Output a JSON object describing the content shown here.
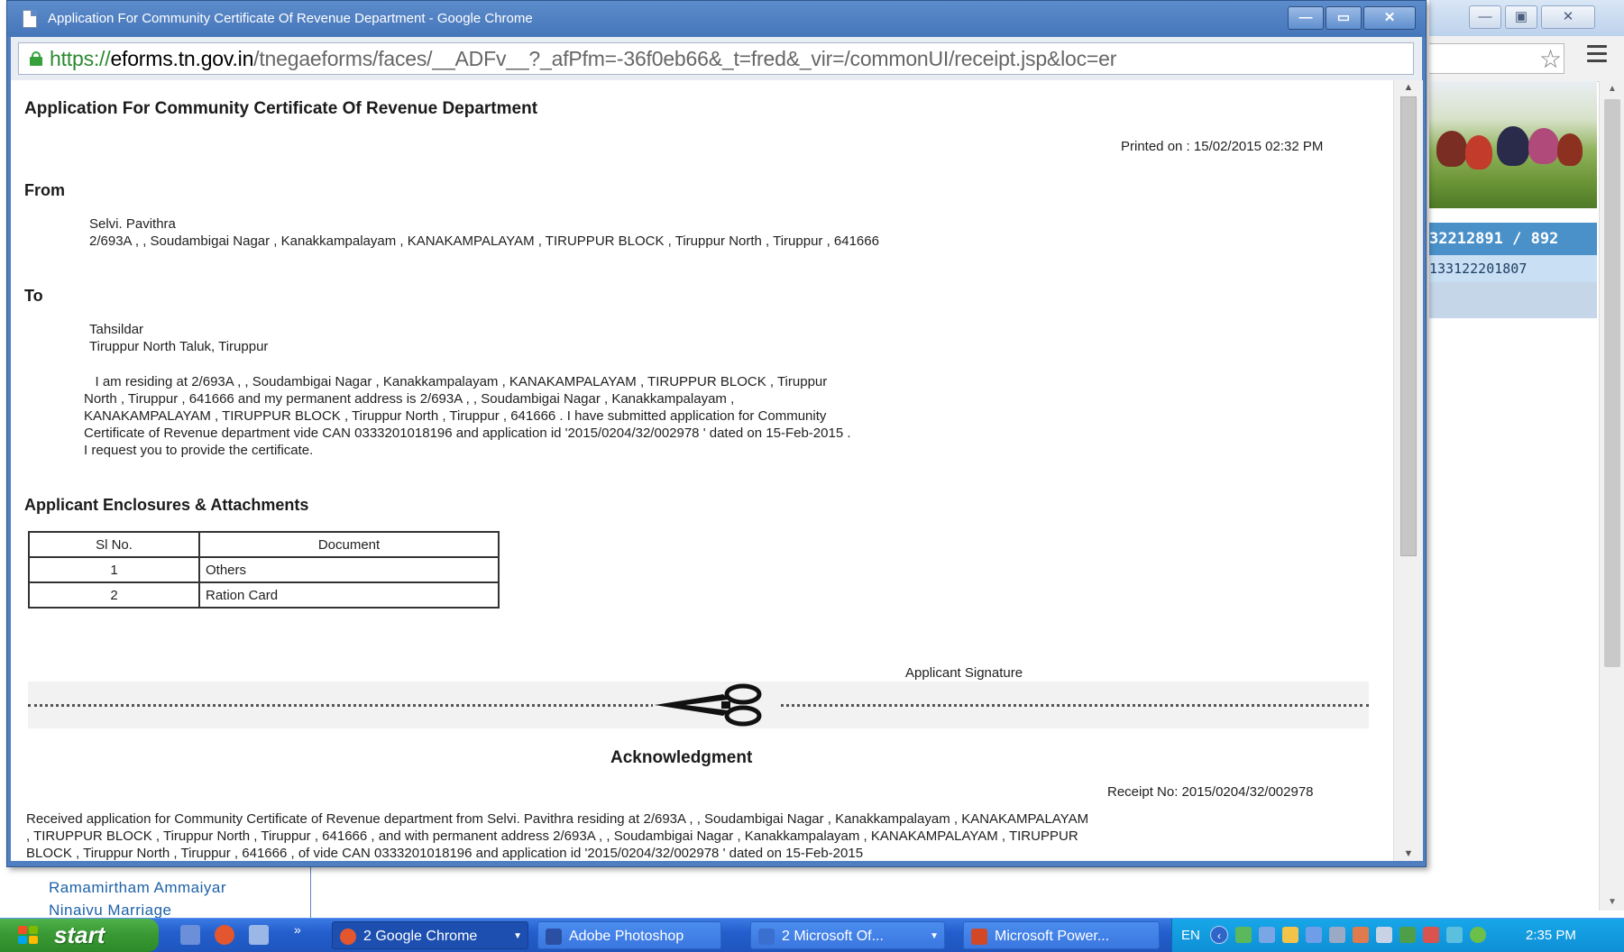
{
  "popup": {
    "title": "Application For Community Certificate Of Revenue Department - Google Chrome",
    "controls": {
      "minimize": "—",
      "maximize": "▭",
      "close": "✕"
    },
    "url_scheme": "https://",
    "url_host": "eforms.tn.gov.in",
    "url_path": "/tnegaeforms/faces/__ADFv__?_afPfm=-36f0eb66&_t=fred&_vir=/commonUI/receipt.jsp&loc=er"
  },
  "document": {
    "heading": "Application For Community Certificate Of Revenue Department",
    "printed_on": "Printed on : 15/02/2015 02:32 PM",
    "from_label": "From",
    "from_name": "Selvi. Pavithra",
    "from_address": "2/693A , , Soudambigai Nagar , Kanakkampalayam , KANAKAMPALAYAM , TIRUPPUR BLOCK , Tiruppur North , Tiruppur , 641666",
    "to_label": "To",
    "to_name": "Tahsildar",
    "to_office": "Tiruppur North Taluk, Tiruppur",
    "body_lines": [
      "   I am residing at 2/693A , , Soudambigai Nagar , Kanakkampalayam , KANAKAMPALAYAM , TIRUPPUR BLOCK , Tiruppur",
      "North , Tiruppur , 641666 and my permanent address is 2/693A , , Soudambigai Nagar , Kanakkampalayam ,",
      "KANAKAMPALAYAM , TIRUPPUR BLOCK , Tiruppur North , Tiruppur , 641666 . I have submitted application for Community",
      "Certificate of Revenue department vide CAN 0333201018196 and application id '2015/0204/32/002978 ' dated on 15-Feb-2015 .",
      "I request you to provide the certificate."
    ],
    "enclosures_heading": "Applicant Enclosures & Attachments",
    "table_headers": [
      "Sl No.",
      "Document"
    ],
    "table_rows": [
      [
        "1",
        "Others"
      ],
      [
        "2",
        "Ration Card"
      ]
    ],
    "signature_label": "Applicant Signature",
    "ack_title": "Acknowledgment",
    "receipt_no": "Receipt No: 2015/0204/32/002978",
    "ack_lines": [
      "Received application for Community Certificate of Revenue department from  Selvi. Pavithra residing at 2/693A , , Soudambigai Nagar , Kanakkampalayam , KANAKAMPALAYAM",
      ", TIRUPPUR BLOCK , Tiruppur North , Tiruppur , 641666 , and with permanent address 2/693A , , Soudambigai Nagar , Kanakkampalayam , KANAKAMPALAYAM , TIRUPPUR",
      "BLOCK , Tiruppur North , Tiruppur , 641666 , of vide CAN 0333201018196 and application id '2015/0204/32/002978 ' dated on 15-Feb-2015"
    ]
  },
  "background_window": {
    "controls": {
      "minimize": "—",
      "maximize": "▣",
      "close": "✕"
    },
    "phone_band": "32212891 / 892",
    "can_band": "133122201807",
    "links": [
      "Ramamirtham Ammaiyar",
      "Ninaivu Marriage"
    ]
  },
  "taskbar": {
    "start_label": "start",
    "more": "»",
    "tasks": [
      {
        "label": "2 Google Chrome",
        "icon": "chrome-icon",
        "color": "#e4572e"
      },
      {
        "label": "Adobe Photoshop",
        "icon": "photoshop-icon",
        "color": "#2b4fa3"
      },
      {
        "label": "2 Microsoft Of...",
        "icon": "office-icon",
        "color": "#3b6fcf"
      },
      {
        "label": "Microsoft Power...",
        "icon": "powerpoint-icon",
        "color": "#d24726"
      }
    ],
    "language": "EN",
    "clock": "2:35 PM"
  }
}
